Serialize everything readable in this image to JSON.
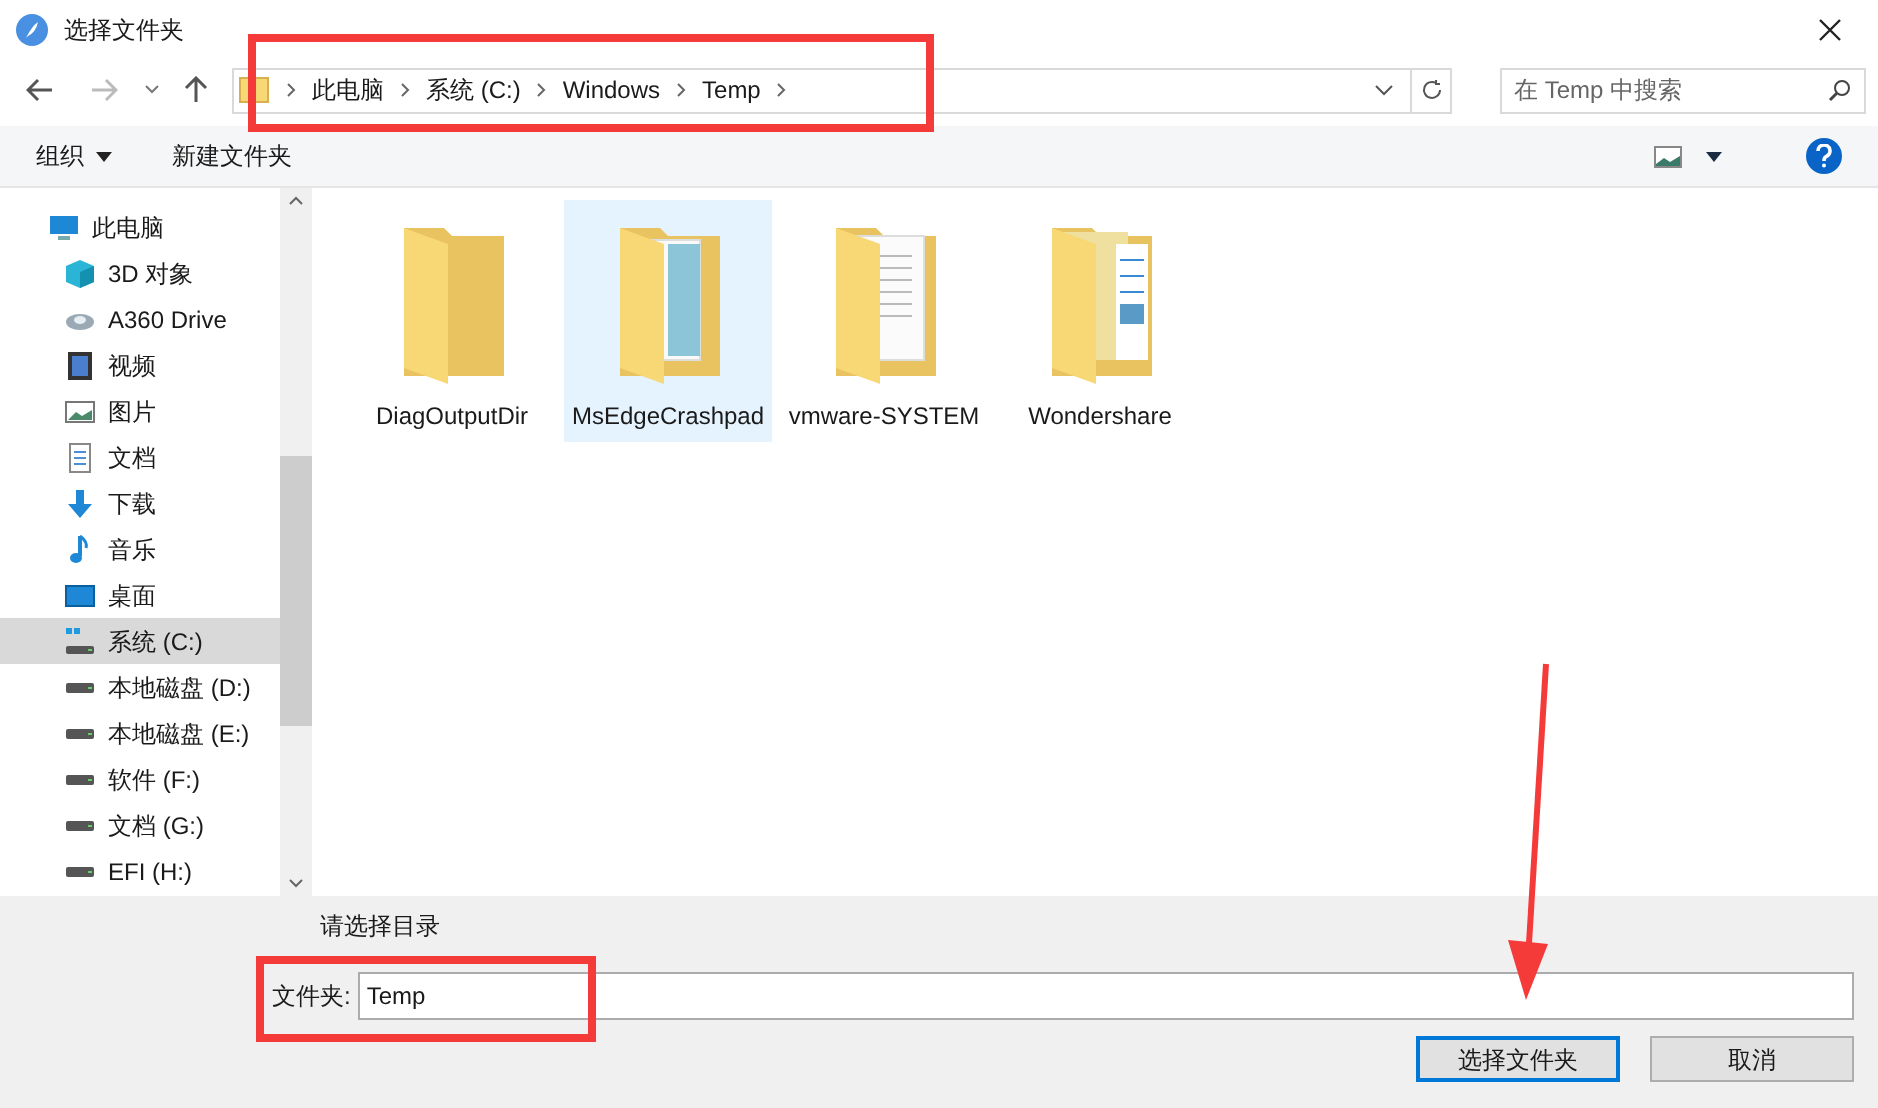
{
  "window": {
    "title": "选择文件夹"
  },
  "address_bar": {
    "segments": [
      "此电脑",
      "系统 (C:)",
      "Windows",
      "Temp"
    ]
  },
  "search": {
    "placeholder": "在 Temp 中搜索"
  },
  "toolbar": {
    "organize": "组织",
    "new_folder": "新建文件夹"
  },
  "sidebar": {
    "items": [
      {
        "label": "此电脑",
        "kind": "pc",
        "selected": false
      },
      {
        "label": "3D 对象",
        "kind": "cube",
        "selected": false
      },
      {
        "label": "A360 Drive",
        "kind": "cloud",
        "selected": false
      },
      {
        "label": "视频",
        "kind": "film",
        "selected": false
      },
      {
        "label": "图片",
        "kind": "picture",
        "selected": false
      },
      {
        "label": "文档",
        "kind": "doc",
        "selected": false
      },
      {
        "label": "下载",
        "kind": "download",
        "selected": false
      },
      {
        "label": "音乐",
        "kind": "music",
        "selected": false
      },
      {
        "label": "桌面",
        "kind": "desktop",
        "selected": false
      },
      {
        "label": "系统 (C:)",
        "kind": "sysdrive",
        "selected": true
      },
      {
        "label": "本地磁盘 (D:)",
        "kind": "drive",
        "selected": false
      },
      {
        "label": "本地磁盘 (E:)",
        "kind": "drive",
        "selected": false
      },
      {
        "label": "软件 (F:)",
        "kind": "drive",
        "selected": false
      },
      {
        "label": "文档 (G:)",
        "kind": "drive",
        "selected": false
      },
      {
        "label": "EFI (H:)",
        "kind": "drive",
        "selected": false
      }
    ]
  },
  "folders": [
    {
      "name": "DiagOutputDir",
      "kind": "empty",
      "selected": false
    },
    {
      "name": "MsEdgeCrashpad",
      "kind": "notebook",
      "selected": true
    },
    {
      "name": "vmware-SYSTEM",
      "kind": "papers",
      "selected": false
    },
    {
      "name": "Wondershare",
      "kind": "pictures",
      "selected": false
    }
  ],
  "bottom": {
    "hint": "请选择目录",
    "field_label": "文件夹:",
    "field_value": "Temp",
    "buttons": [
      {
        "label": "选择文件夹",
        "primary": true
      },
      {
        "label": "取消",
        "primary": false
      }
    ]
  }
}
